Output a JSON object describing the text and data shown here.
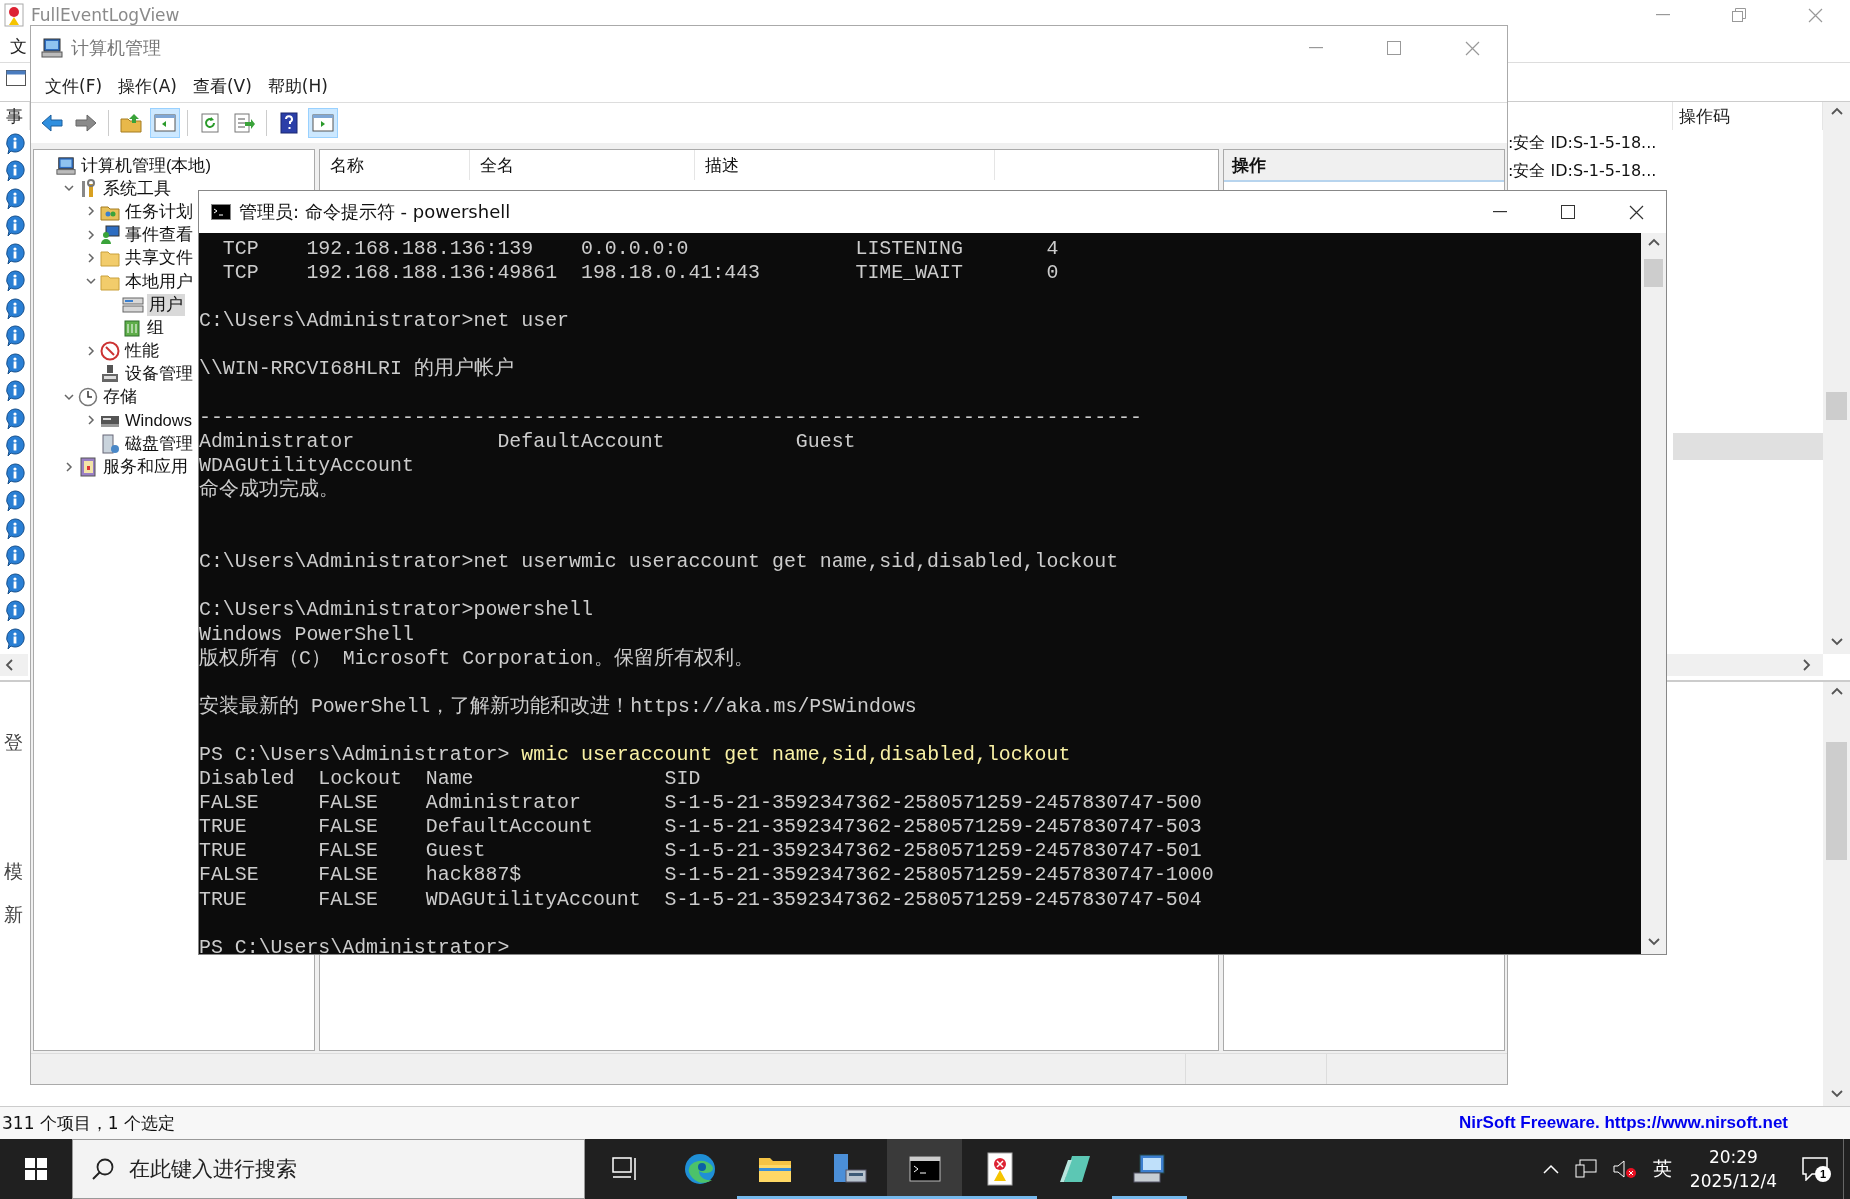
{
  "background_window": {
    "title": "FullEventLogView",
    "menu": [
      "文"
    ],
    "columns": [
      {
        "label": "事"
      },
      {
        "label": "操作码"
      }
    ],
    "rows": [
      {
        "text": ":安全 ID:S-1-5-18...",
        "selected": false
      },
      {
        "text": ":安全 ID:S-1-5-18...",
        "selected": false
      },
      {
        "selected": false
      },
      {
        "selected": false
      },
      {
        "selected": false
      },
      {
        "selected": false
      },
      {
        "selected": false
      },
      {
        "selected": false
      },
      {
        "selected": false
      },
      {
        "selected": false
      },
      {
        "selected": false
      },
      {
        "selected": true
      },
      {
        "selected": false
      },
      {
        "selected": false
      },
      {
        "selected": false
      },
      {
        "selected": false
      },
      {
        "selected": false
      },
      {
        "selected": false
      },
      {
        "selected": false
      }
    ],
    "detail_lines": [
      "登",
      "模",
      "新"
    ],
    "status_text": "311 个项目，1 个选定",
    "status_link": "NirSoft Freeware. https://www.nirsoft.net"
  },
  "management_window": {
    "title": "计算机管理",
    "menu": [
      "文件(F)",
      "操作(A)",
      "查看(V)",
      "帮助(H)"
    ],
    "toolbar": [
      {
        "kind": "back",
        "pressed": false
      },
      {
        "kind": "forward",
        "pressed": false
      },
      {
        "kind": "up",
        "pressed": false
      },
      {
        "kind": "tree",
        "pressed": true
      },
      {
        "kind": "refresh",
        "pressed": false
      },
      {
        "kind": "export",
        "pressed": false
      },
      {
        "kind": "help",
        "pressed": false
      },
      {
        "kind": "pane",
        "pressed": true
      }
    ],
    "tree": [
      {
        "label": "计算机管理(本地)",
        "selected": false,
        "children": [
          {
            "label": "系统工具",
            "selected": false,
            "expanded": true,
            "children": [
              {
                "label": "任务计划",
                "selected": false,
                "expanded": false
              },
              {
                "label": "事件查看",
                "selected": false,
                "expanded": false
              },
              {
                "label": "共享文件",
                "selected": false,
                "expanded": false
              },
              {
                "label": "本地用户",
                "selected": false,
                "expanded": true,
                "children": [
                  {
                    "label": "用户",
                    "selected": true
                  },
                  {
                    "label": "组",
                    "selected": false
                  }
                ]
              },
              {
                "label": "性能",
                "selected": false,
                "expanded": false
              },
              {
                "label": "设备管理",
                "selected": false
              }
            ]
          },
          {
            "label": "存储",
            "selected": false,
            "expanded": true,
            "children": [
              {
                "label": "Windows",
                "selected": false,
                "expanded": false
              },
              {
                "label": "磁盘管理",
                "selected": false
              }
            ]
          },
          {
            "label": "服务和应用",
            "selected": false,
            "expanded": false
          }
        ]
      }
    ],
    "columns": [
      "名称",
      "全名",
      "描述"
    ],
    "actions_title": "操作"
  },
  "console_window": {
    "title": "管理员: 命令提示符 - powershell",
    "lines": [
      {
        "kind": "output",
        "text": "  TCP    192.168.188.136:139    0.0.0.0:0              LISTENING       4"
      },
      {
        "kind": "output",
        "text": "  TCP    192.168.188.136:49861  198.18.0.41:443        TIME_WAIT       0"
      },
      {
        "kind": "blank"
      },
      {
        "kind": "output",
        "text": "C:\\Users\\Administrator>net user"
      },
      {
        "kind": "blank"
      },
      {
        "kind": "output",
        "text": "\\\\WIN-RRCVI68HLRI 的用户帐户"
      },
      {
        "kind": "blank"
      },
      {
        "kind": "output",
        "text": "-------------------------------------------------------------------------------"
      },
      {
        "kind": "output",
        "text": "Administrator            DefaultAccount           Guest"
      },
      {
        "kind": "output",
        "text": "WDAGUtilityAccount"
      },
      {
        "kind": "output",
        "text": "命令成功完成。"
      },
      {
        "kind": "blank"
      },
      {
        "kind": "blank"
      },
      {
        "kind": "output",
        "text": "C:\\Users\\Administrator>net userwmic useraccount get name,sid,disabled,lockout"
      },
      {
        "kind": "blank"
      },
      {
        "kind": "output",
        "text": "C:\\Users\\Administrator>powershell"
      },
      {
        "kind": "output",
        "text": "Windows PowerShell"
      },
      {
        "kind": "output",
        "text": "版权所有（C） Microsoft Corporation。保留所有权利。"
      },
      {
        "kind": "blank"
      },
      {
        "kind": "output",
        "text": "安装最新的 PowerShell，了解新功能和改进！https://aka.ms/PSWindows"
      },
      {
        "kind": "blank"
      },
      {
        "kind": "command",
        "prompt": "PS C:\\Users\\Administrator>",
        "command": "wmic useraccount get name,sid,disabled,lockout"
      },
      {
        "kind": "output",
        "text": "Disabled  Lockout  Name                SID"
      },
      {
        "kind": "output",
        "text": "FALSE     FALSE    Administrator       S-1-5-21-3592347362-2580571259-2457830747-500"
      },
      {
        "kind": "output",
        "text": "TRUE      FALSE    DefaultAccount      S-1-5-21-3592347362-2580571259-2457830747-503"
      },
      {
        "kind": "output",
        "text": "TRUE      FALSE    Guest               S-1-5-21-3592347362-2580571259-2457830747-501"
      },
      {
        "kind": "output",
        "text": "FALSE     FALSE    hack887$            S-1-5-21-3592347362-2580571259-2457830747-1000"
      },
      {
        "kind": "output",
        "text": "TRUE      FALSE    WDAGUtilityAccount  S-1-5-21-3592347362-2580571259-2457830747-504"
      },
      {
        "kind": "blank"
      },
      {
        "kind": "command",
        "prompt": "PS C:\\Users\\Administrator>"
      }
    ]
  },
  "taskbar": {
    "search_placeholder": "在此键入进行搜索",
    "apps": [
      {
        "kind": "task_view",
        "running": false,
        "active": false
      },
      {
        "kind": "edge",
        "running": false,
        "active": false
      },
      {
        "kind": "explorer",
        "running": true,
        "active": false
      },
      {
        "kind": "management",
        "running": true,
        "active": false
      },
      {
        "kind": "console",
        "running": true,
        "active": true
      },
      {
        "kind": "eventlog",
        "running": true,
        "active": false
      },
      {
        "kind": "notepad",
        "running": false,
        "active": false
      },
      {
        "kind": "network",
        "running": true,
        "active": false
      }
    ],
    "ime": "英",
    "time": "20:29",
    "date": "2025/12/4",
    "notification_count": "1"
  }
}
